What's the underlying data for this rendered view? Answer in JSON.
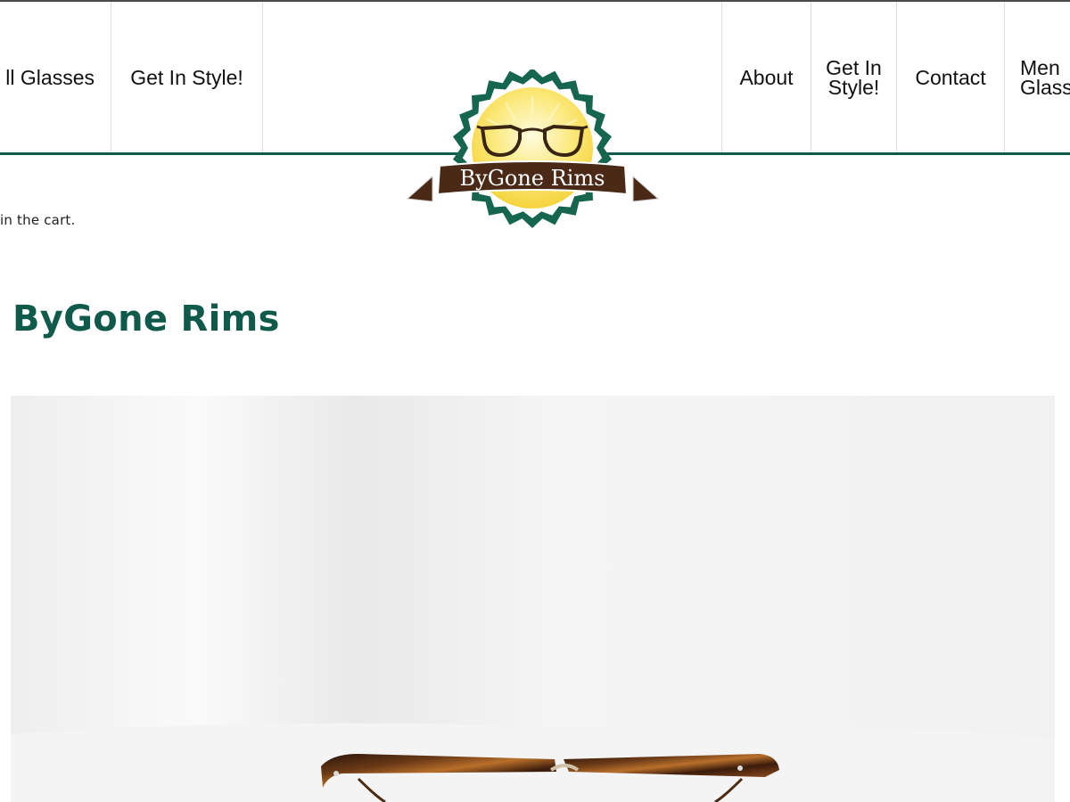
{
  "nav": {
    "left_items": [
      {
        "label": "ll Glasses"
      },
      {
        "label": "Get In Style!"
      }
    ],
    "right_items": [
      {
        "label": "About"
      },
      {
        "label": "Get In Style!"
      },
      {
        "label": "Contact"
      },
      {
        "label": "Men Glass"
      }
    ]
  },
  "logo": {
    "text": "ByGone Rims",
    "colors": {
      "badge_outer": "#15654f",
      "badge_inner": "#f7d94a",
      "banner": "#4a2a16"
    }
  },
  "cart_note": "in the cart.",
  "page_title": "ByGone Rims",
  "hero": {
    "alt": "Tortoiseshell browline eyeglasses on white fabric",
    "icon": "glasses-photo"
  },
  "colors": {
    "accent": "#0f5a4b",
    "nav_text": "#111111",
    "divider": "#dedede"
  }
}
